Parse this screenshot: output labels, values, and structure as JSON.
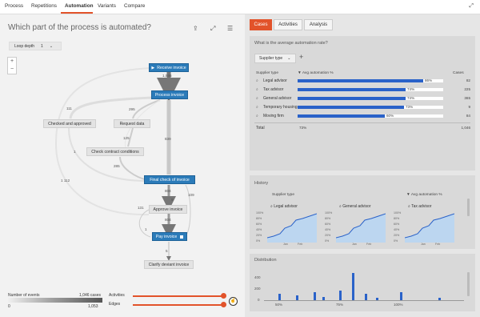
{
  "nav": {
    "tabs": [
      "Process",
      "Repetitions",
      "Automation",
      "Variants",
      "Compare"
    ],
    "active": "Automation"
  },
  "left": {
    "question": "Which part of the process is automated?",
    "loop_depth_label": "Loop depth",
    "loop_depth_value": "1",
    "zoom_in": "+",
    "zoom_out": "−"
  },
  "process": {
    "nodes": {
      "receive": "Receive invoice",
      "process": "Process invoice",
      "checked": "Checked and approved",
      "request": "Request data",
      "contract": "Check contract conditions",
      "final": "Final check of invoice",
      "approve": "Approve invoice",
      "pay": "Pay invoice",
      "clarify": "Clarify deviant invoice"
    },
    "edge_labels": {
      "e1596": "1,596",
      "e111": "111",
      "e295": "295",
      "e839": "839",
      "e125": "125",
      "e285": "285",
      "e1112": "1 112",
      "e1a": "1",
      "e804": "804",
      "e131": "131",
      "e9": "9",
      "e109": "109",
      "e1b": "1",
      "e804b": "804",
      "e5": "5"
    }
  },
  "controls": {
    "events_label": "Number of events",
    "cases_label": "1,046 cases",
    "min": "0",
    "max": "1,053",
    "activities_label": "Activities",
    "edges_label": "Edges"
  },
  "right": {
    "tabs": [
      "Cases",
      "Activities",
      "Analysis"
    ],
    "active_tab": "Cases",
    "automation_card": {
      "title": "What is the average automation rate?",
      "filter_pill": "Supplier type",
      "add": "+",
      "col_supplier": "Supplier type",
      "col_avg": "▼ Avg automation %",
      "col_cases": "Cases",
      "rows": [
        {
          "label": "Legal advisor",
          "pct": 0.86,
          "pct_label": "86%",
          "cases": "82"
        },
        {
          "label": "Tax advisor",
          "pct": 0.74,
          "pct_label": "74%",
          "cases": "225"
        },
        {
          "label": "General advisor",
          "pct": 0.74,
          "pct_label": "74%",
          "cases": "365"
        },
        {
          "label": "Temporary housing",
          "pct": 0.73,
          "pct_label": "73%",
          "cases": "9"
        },
        {
          "label": "Moving firm",
          "pct": 0.6,
          "pct_label": "60%",
          "cases": "84"
        }
      ],
      "total_label": "Total",
      "total_pct": "73%",
      "total_cases": "1,046"
    },
    "history_card": {
      "title": "History",
      "col_supplier": "Supplier type",
      "col_avg": "▼ Avg automation %",
      "minis": [
        "Legal advisor",
        "General advisor",
        "Tax advisor"
      ],
      "y_ticks": [
        "100%",
        "80%",
        "60%",
        "40%",
        "20%",
        "0%"
      ],
      "x_ticks": [
        "Jan",
        "Feb"
      ]
    },
    "distribution_card": {
      "title": "Distribution",
      "y_ticks": [
        "400",
        "200",
        "0"
      ],
      "x_ticks": [
        "50%",
        "75%",
        "100%"
      ]
    }
  },
  "colors": {
    "accent": "#e2532a",
    "node_blue": "#2b7bb9",
    "bar_blue": "#2a62c9"
  }
}
